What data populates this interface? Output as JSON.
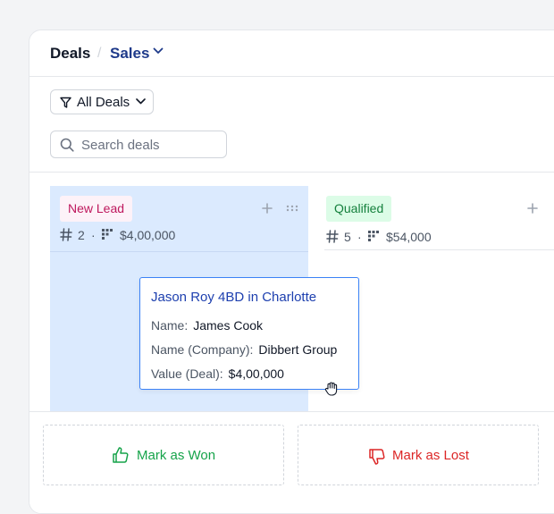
{
  "breadcrumb": {
    "root": "Deals",
    "separator": "/",
    "current": "Sales"
  },
  "filter": {
    "label": "All Deals"
  },
  "search": {
    "placeholder": "Search deals",
    "value": ""
  },
  "columns": [
    {
      "tag": "New Lead",
      "count": "2",
      "amount": "$4,00,000",
      "tag_bg": "#fdf2f8",
      "tag_color": "#be185d",
      "highlighted": true
    },
    {
      "tag": "Qualified",
      "count": "5",
      "amount": "$54,000",
      "tag_bg": "#dcfce7",
      "tag_color": "#15803d",
      "highlighted": false
    }
  ],
  "card": {
    "title": "Jason Roy 4BD in Charlotte",
    "fields": [
      {
        "label": "Name:",
        "value": "James Cook"
      },
      {
        "label": "Name (Company):",
        "value": "Dibbert Group"
      },
      {
        "label": "Value (Deal):",
        "value": "$4,00,000"
      }
    ]
  },
  "footer": {
    "won_label": "Mark as Won",
    "lost_label": "Mark as Lost"
  },
  "icons": [
    "chevron-down-icon",
    "filter-icon",
    "search-icon",
    "hash-icon",
    "kanban-icon",
    "plus-icon",
    "drag-handle-icon",
    "thumbs-up-icon",
    "thumbs-down-icon",
    "grab-cursor-icon"
  ],
  "colors": {
    "accent": "#1e3a8a",
    "highlight": "#dbeafe",
    "won": "#16a34a",
    "lost": "#dc2626",
    "card_border": "#3b82f6"
  }
}
